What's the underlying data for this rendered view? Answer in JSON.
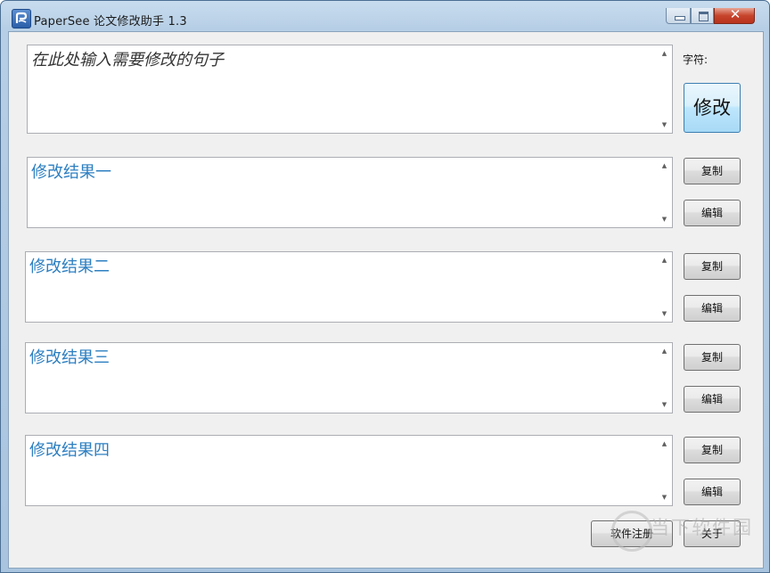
{
  "window": {
    "title": "PaperSee 论文修改助手 1.3",
    "close_glyph": "✕"
  },
  "input": {
    "placeholder_text": "在此处输入需要修改的句子"
  },
  "char_label": "字符:",
  "modify_button": "修改",
  "results": [
    {
      "text": "修改结果一",
      "copy_label": "复制",
      "edit_label": "编辑"
    },
    {
      "text": "修改结果二",
      "copy_label": "复制",
      "edit_label": "编辑"
    },
    {
      "text": "修改结果三",
      "copy_label": "复制",
      "edit_label": "编辑"
    },
    {
      "text": "修改结果四",
      "copy_label": "复制",
      "edit_label": "编辑"
    }
  ],
  "footer": {
    "register_label": "软件注册",
    "about_label": "关于"
  },
  "watermark": {
    "text": "当下软件园"
  },
  "icons": {
    "app": "papersee-logo-icon",
    "minimize": "minimize-icon",
    "maximize": "maximize-icon",
    "close": "close-icon",
    "scroll_up": "scroll-up-arrow-icon",
    "scroll_down": "scroll-down-arrow-icon"
  },
  "colors": {
    "result_text": "#2d7fc1",
    "close_button": "#c7442c",
    "modify_button_border": "#3c7fb1"
  }
}
